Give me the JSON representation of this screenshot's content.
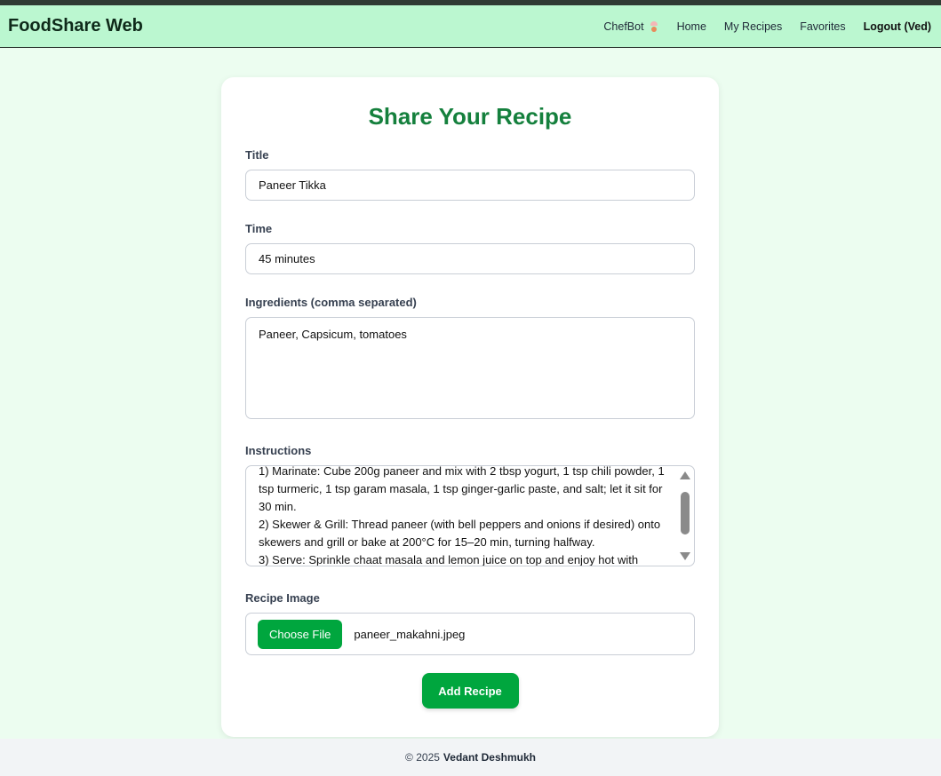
{
  "navbar": {
    "brand": "FoodShare Web",
    "links": [
      {
        "label": "ChefBot"
      },
      {
        "label": "Home"
      },
      {
        "label": "My Recipes"
      },
      {
        "label": "Favorites"
      },
      {
        "label": "Logout (Ved)"
      }
    ]
  },
  "form": {
    "heading": "Share Your Recipe",
    "title": {
      "label": "Title",
      "value": "Paneer Tikka"
    },
    "time": {
      "label": "Time",
      "value": "45 minutes"
    },
    "ingredients": {
      "label": "Ingredients (comma separated)",
      "value": "Paneer, Capsicum, tomatoes"
    },
    "instructions": {
      "label": "Instructions",
      "value": "1) Marinate: Cube 200g paneer and mix with 2 tbsp yogurt, 1 tsp chili powder, 1 tsp turmeric, 1 tsp garam masala, 1 tsp ginger-garlic paste, and salt; let it sit for 30 min.\n2) Skewer & Grill: Thread paneer (with bell peppers and onions if desired) onto skewers and grill or bake at 200°C for 15–20 min, turning halfway.\n3) Serve: Sprinkle chaat masala and lemon juice on top and enjoy hot with"
    },
    "image": {
      "label": "Recipe Image",
      "button": "Choose File",
      "file_name": "paneer_makahni.jpeg"
    },
    "submit": "Add Recipe"
  },
  "footer": {
    "copyright": "© 2025",
    "author": "Vedant Deshmukh"
  },
  "colors": {
    "accent": "#00a63e",
    "heading": "#15803d",
    "navbar": "#bbf7d0",
    "background": "#ecfdf0"
  }
}
